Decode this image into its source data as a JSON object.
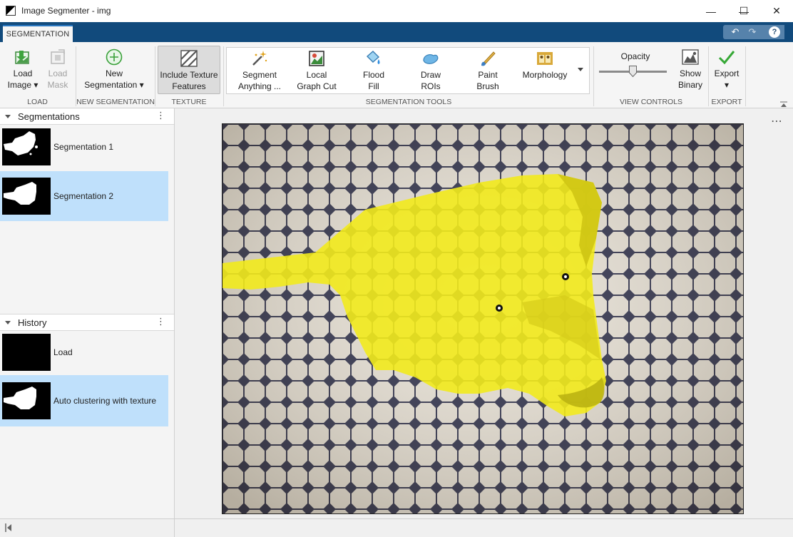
{
  "window": {
    "title": "Image Segmenter - img",
    "minimize": "—",
    "maximize": "☐",
    "close": "✕"
  },
  "tabs": [
    {
      "label": "SEGMENTATION"
    }
  ],
  "quick_access": {
    "undo": "↶",
    "redo": "↷",
    "help": "?"
  },
  "toolstrip": {
    "sections": {
      "load": "LOAD",
      "new_segmentation": "NEW SEGMENTATION",
      "texture": "TEXTURE",
      "segmentation_tools": "SEGMENTATION TOOLS",
      "view_controls": "VIEW CONTROLS",
      "export": "EXPORT"
    },
    "load_image": {
      "line1": "Load",
      "line2": "Image ▾"
    },
    "load_mask": {
      "line1": "Load",
      "line2": "Mask"
    },
    "new_segmentation": {
      "line1": "New",
      "line2": "Segmentation ▾"
    },
    "include_texture": {
      "line1": "Include Texture",
      "line2": "Features"
    },
    "tools": [
      {
        "line1": "Segment",
        "line2": "Anything ...",
        "icon": "magic-wand-icon"
      },
      {
        "line1": "Local",
        "line2": "Graph Cut",
        "icon": "graph-cut-icon"
      },
      {
        "line1": "Flood",
        "line2": "Fill",
        "icon": "flood-fill-icon"
      },
      {
        "line1": "Draw",
        "line2": "ROIs",
        "icon": "draw-roi-icon"
      },
      {
        "line1": "Paint",
        "line2": "Brush",
        "icon": "paint-brush-icon"
      },
      {
        "line1": "Morphology",
        "line2": "",
        "icon": "morphology-icon"
      }
    ],
    "opacity": {
      "label": "Opacity",
      "value": 0.5
    },
    "show_binary": {
      "line1": "Show",
      "line2": "Binary"
    },
    "export": {
      "line1": "Export",
      "line2": "▾"
    }
  },
  "segmentations_panel": {
    "title": "Segmentations",
    "items": [
      {
        "label": "Segmentation 1",
        "selected": false
      },
      {
        "label": "Segmentation 2",
        "selected": true
      }
    ]
  },
  "history_panel": {
    "title": "History",
    "items": [
      {
        "label": "Load",
        "selected": false
      },
      {
        "label": "Auto clustering with texture",
        "selected": true
      }
    ]
  },
  "main": {
    "more": "⋯"
  },
  "colors": {
    "accent": "#114a7c",
    "selection": "#bfe0fb",
    "overlay": "#f2ea1c"
  }
}
